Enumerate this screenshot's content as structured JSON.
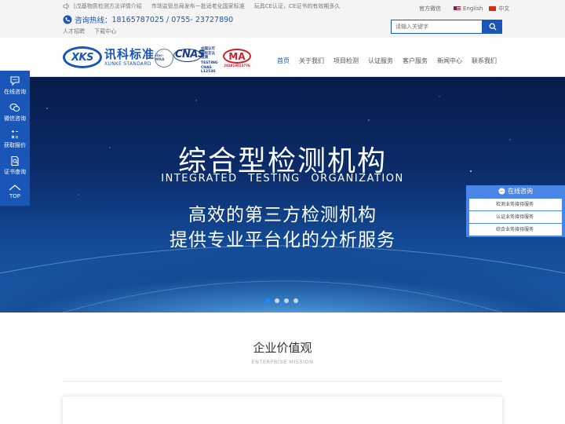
{
  "topbar": {
    "news": [
      "[戊基物质检测方法详情介绍",
      "市场监管总局发布一批适老化国家标准",
      "玩具CE认证，CE证书的有效期多久"
    ],
    "hotline_label": "咨询热线：",
    "hotline_numbers": "18165787025 / 0755- 23727890",
    "sublinks": [
      "人才招聘",
      "下载中心"
    ],
    "official_wechat": "官方微信",
    "lang_en": "English",
    "lang_cn": "中文",
    "search_placeholder": "请输入关键字"
  },
  "header": {
    "logo_mark": "XKS",
    "logo_cn": "讯科标准",
    "logo_en": "XUNKE STANDARD",
    "cert_ilac": "ilac-MRA",
    "cert_cnas": "CNAS",
    "cert_cnas_cn": [
      "中国认可",
      "国际互认",
      "检测"
    ],
    "cert_cnas_en": [
      "TESTING",
      "CNAS L12530"
    ],
    "cert_ma": "MA",
    "cert_ma_num": "201819013776",
    "nav": [
      "首页",
      "关于我们",
      "项目检测",
      "认证服务",
      "客户服务",
      "新闻中心",
      "联系我们"
    ],
    "nav_active_index": 0
  },
  "banner": {
    "title": "综合型检测机构",
    "subtitle": "INTEGRATED TESTING ORGANIZATION",
    "line1": "高效的第三方检测机构",
    "line2": "提供专业平台化的分析服务",
    "slide_count": 4,
    "active_slide": 0
  },
  "sidebar": {
    "items": [
      "在线咨询",
      "微信咨询",
      "获取报价",
      "证书查询",
      "TOP"
    ]
  },
  "chat": {
    "title": "在线咨询",
    "items": [
      "检测业务接待服务",
      "认证业务接待服务",
      "综合业务接待服务"
    ]
  },
  "section": {
    "title": "企业价值观",
    "subtitle": "ENTERPRISE MISSION"
  },
  "colors": {
    "brand": "#1a56b8",
    "chat": "#4a86e8",
    "ma_red": "#d0202a"
  }
}
